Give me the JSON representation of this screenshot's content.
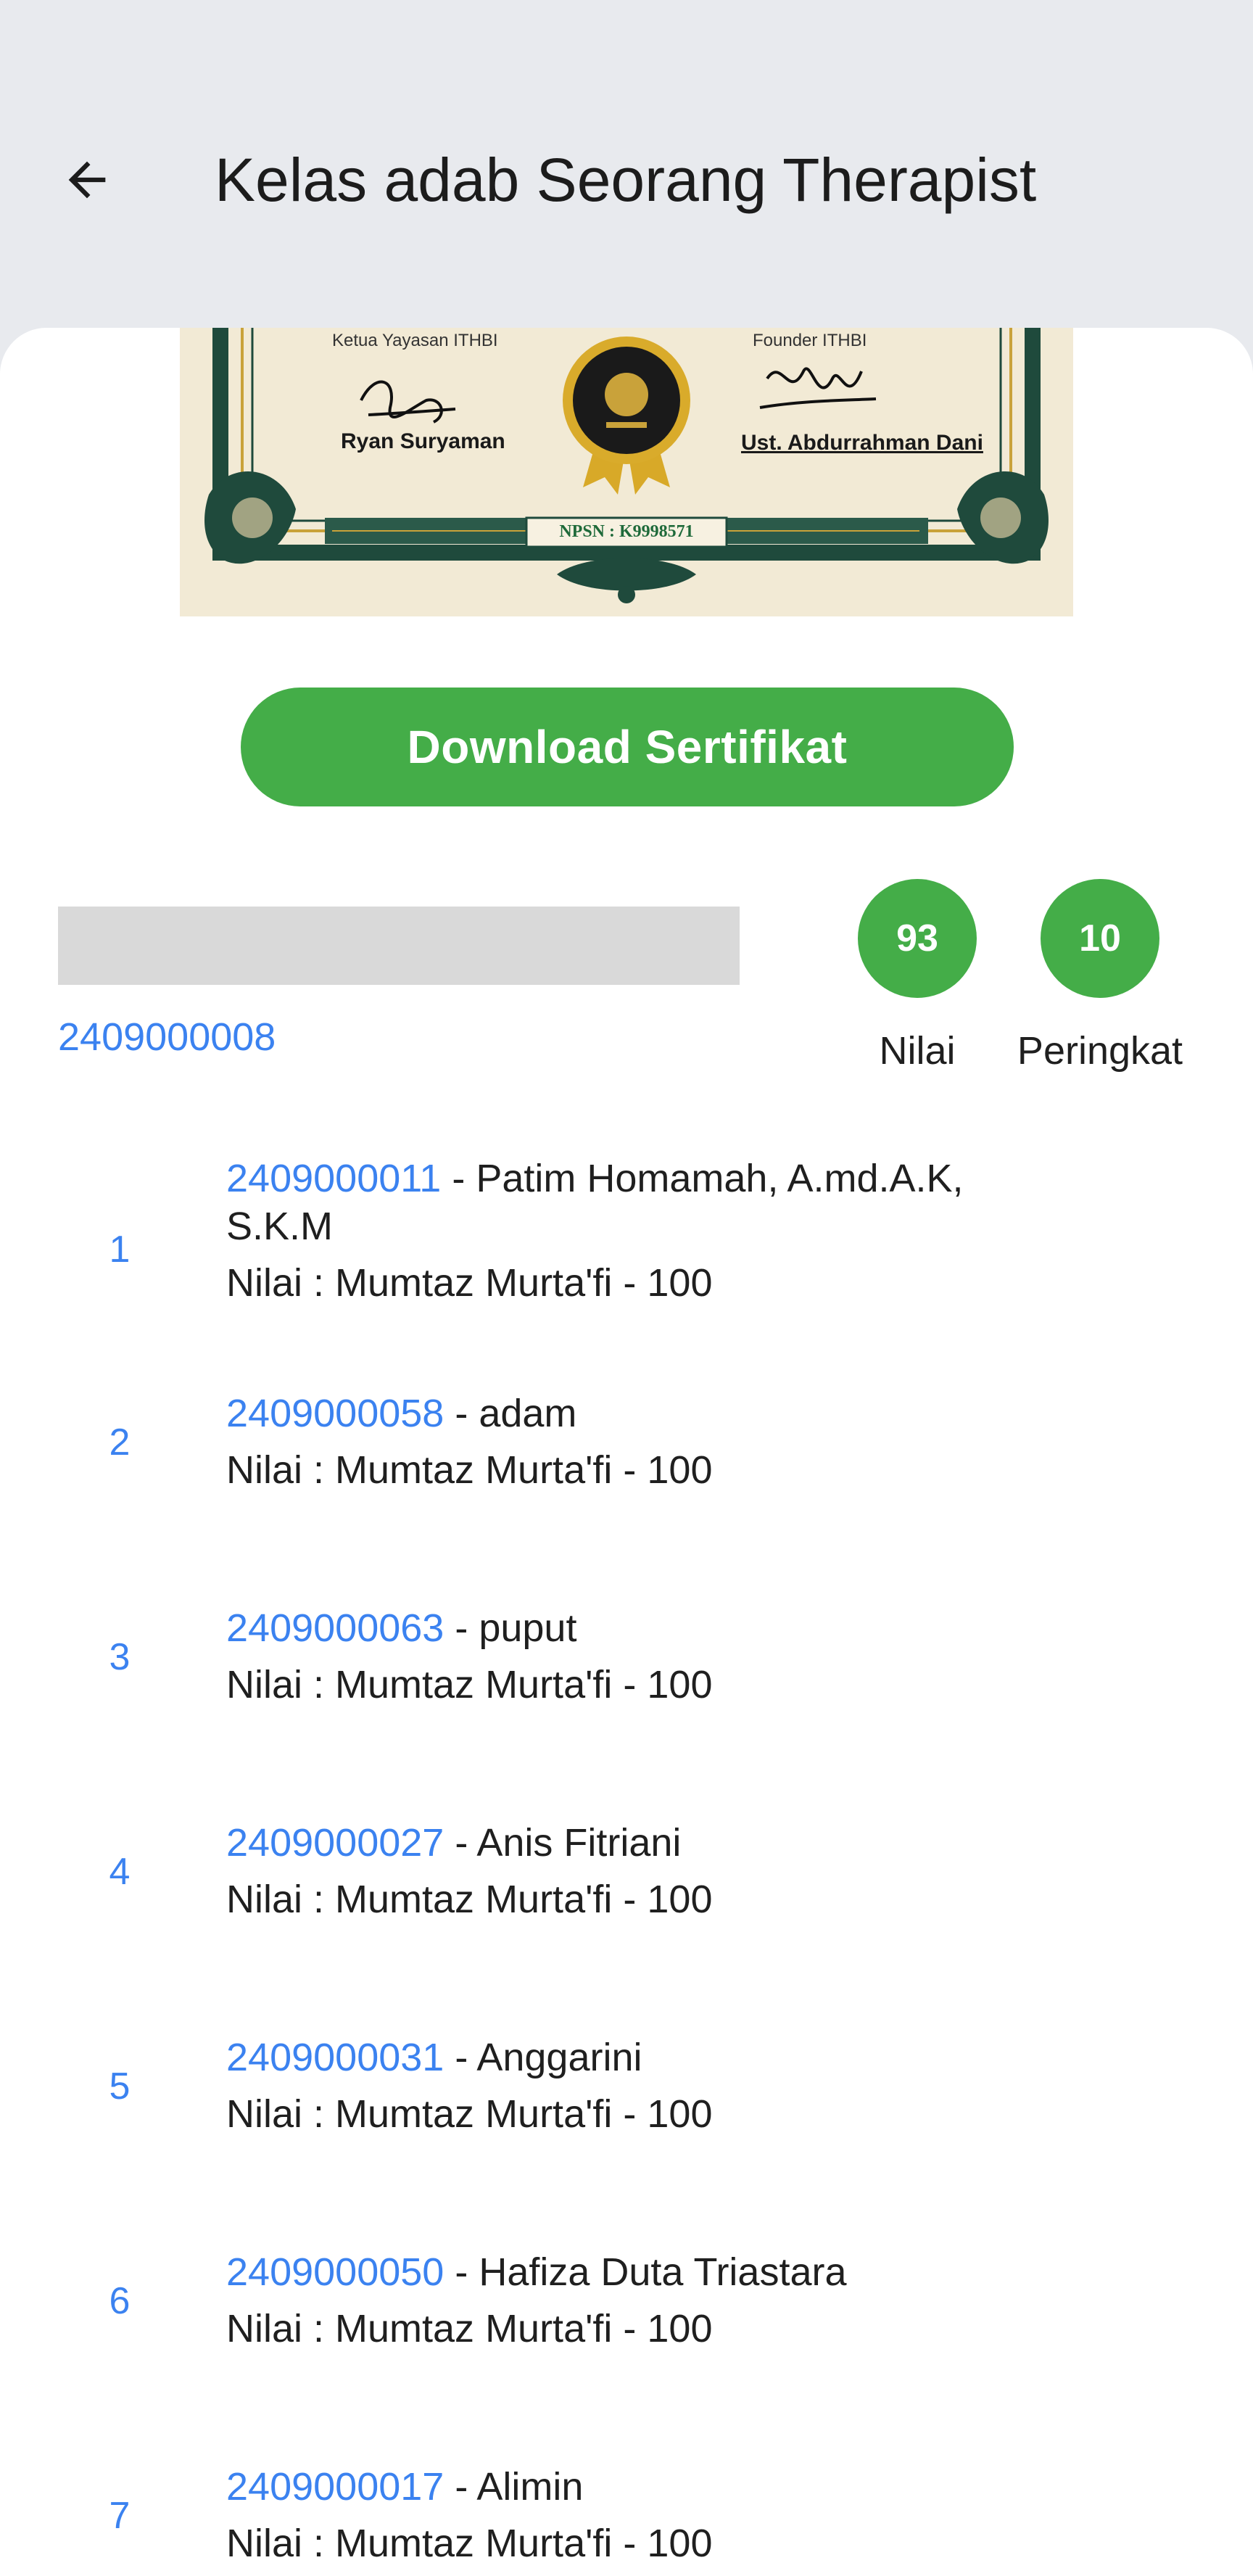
{
  "appbar": {
    "title": "Kelas adab Seorang Therapist",
    "back_icon": "arrow-left-icon"
  },
  "certificate": {
    "left_role": "Ketua Yayasan ITHBI",
    "left_name": "Ryan Suryaman",
    "right_role": "Founder ITHBI",
    "right_name": "Ust. Abdurrahman Dani",
    "npsn": "NPSN : K9998571",
    "colors": {
      "paper": "#f2ead5",
      "border": "#1f4a3c",
      "gold": "#c9a23a"
    }
  },
  "download_button": {
    "label": "Download Sertifikat"
  },
  "user": {
    "id": "2409000008",
    "score": "93",
    "score_label": "Nilai",
    "rank": "10",
    "rank_label": "Peringkat"
  },
  "ranking": [
    {
      "no": "1",
      "id": "2409000011",
      "name": " - Patim Homamah, A.md.A.K,",
      "name2": "S.K.M",
      "score": "Nilai : Mumtaz Murta'fi - 100"
    },
    {
      "no": "2",
      "id": "2409000058",
      "name": " - adam",
      "name2": "",
      "score": "Nilai : Mumtaz Murta'fi - 100"
    },
    {
      "no": "3",
      "id": "2409000063",
      "name": " - puput",
      "name2": "",
      "score": "Nilai : Mumtaz Murta'fi - 100"
    },
    {
      "no": "4",
      "id": "2409000027",
      "name": " - Anis Fitriani",
      "name2": "",
      "score": "Nilai : Mumtaz Murta'fi - 100"
    },
    {
      "no": "5",
      "id": "2409000031",
      "name": " - Anggarini",
      "name2": "",
      "score": "Nilai : Mumtaz Murta'fi - 100"
    },
    {
      "no": "6",
      "id": "2409000050",
      "name": " - Hafiza Duta Triastara",
      "name2": "",
      "score": "Nilai : Mumtaz Murta'fi - 100"
    },
    {
      "no": "7",
      "id": "2409000017",
      "name": " - Alimin",
      "name2": "",
      "score": "Nilai : Mumtaz Murta'fi - 100"
    }
  ],
  "colors": {
    "accent": "#44ad48",
    "link": "#3b82f0",
    "appbar": "#e8eaee"
  }
}
